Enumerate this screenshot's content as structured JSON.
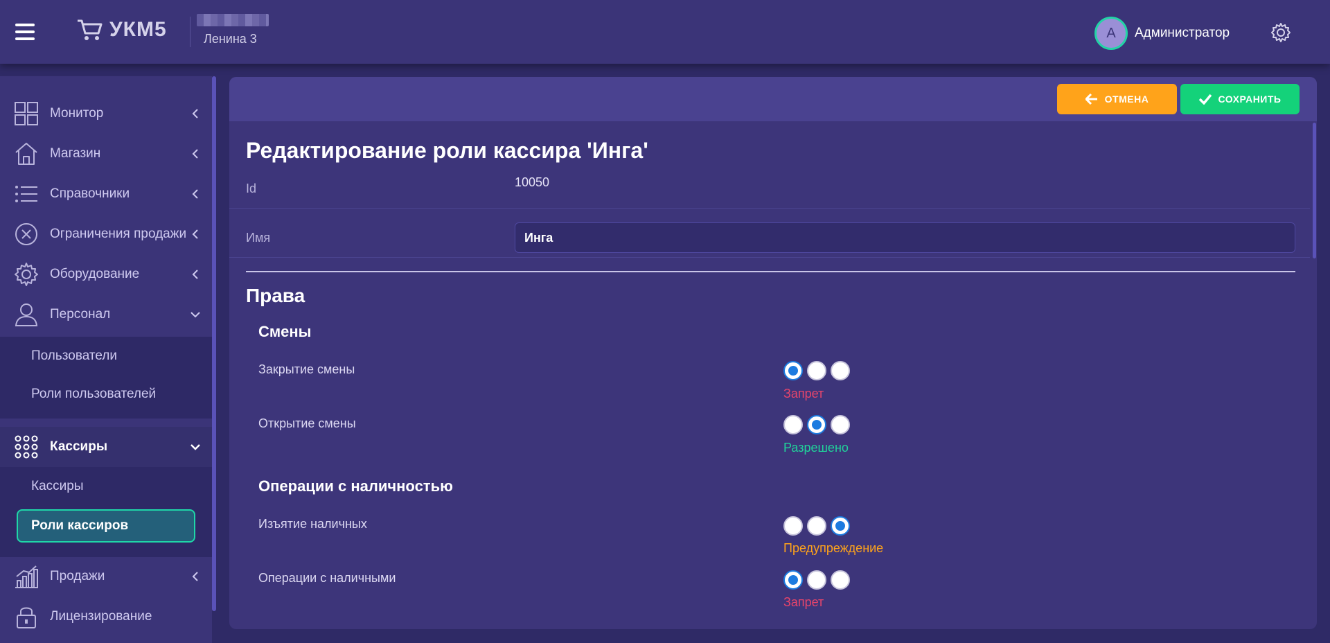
{
  "header": {
    "app_name": "УКМ5",
    "store_name": "Ленина 3",
    "user_initial": "A",
    "user_name": "Администратор"
  },
  "sidebar": {
    "items": [
      {
        "label": "Монитор",
        "icon": "monitor-grid-icon"
      },
      {
        "label": "Магазин",
        "icon": "store-icon"
      },
      {
        "label": "Справочники",
        "icon": "list-icon"
      },
      {
        "label": "Ограничения продажи",
        "icon": "restriction-icon"
      },
      {
        "label": "Оборудование",
        "icon": "gear-icon"
      },
      {
        "label": "Персонал",
        "icon": "person-icon"
      },
      {
        "label": "Кассиры",
        "icon": "keypad-icon"
      },
      {
        "label": "Продажи",
        "icon": "sales-chart-icon"
      },
      {
        "label": "Лицензирование",
        "icon": "lock-icon"
      }
    ],
    "personnel_sub": [
      "Пользователи",
      "Роли пользователей"
    ],
    "cashiers_sub": [
      "Кассиры",
      "Роли кассиров"
    ]
  },
  "toolbar": {
    "cancel_label": "ОТМЕНА",
    "save_label": "СОХРАНИТЬ"
  },
  "form": {
    "title": "Редактирование роли кассира 'Инга'",
    "id_label": "Id",
    "id_value": "10050",
    "name_label": "Имя",
    "name_value": "Инга"
  },
  "rights": {
    "section_title": "Права",
    "groups": [
      {
        "title": "Смены",
        "perms": [
          {
            "label": "Закрытие смены",
            "selected": 0,
            "status": "Запрет"
          },
          {
            "label": "Открытие смены",
            "selected": 1,
            "status": "Разрешено"
          }
        ]
      },
      {
        "title": "Операции с наличностью",
        "perms": [
          {
            "label": "Изъятие наличных",
            "selected": 2,
            "status": "Предупреждение"
          },
          {
            "label": "Операции с наличными",
            "selected": 0,
            "status": "Запрет"
          }
        ]
      }
    ]
  },
  "colors": {
    "status_deny": "#e8456b",
    "status_allow": "#20d49a",
    "status_warn": "#ffa31a",
    "accent_cancel": "#ffa31a",
    "accent_save": "#14d27a"
  }
}
